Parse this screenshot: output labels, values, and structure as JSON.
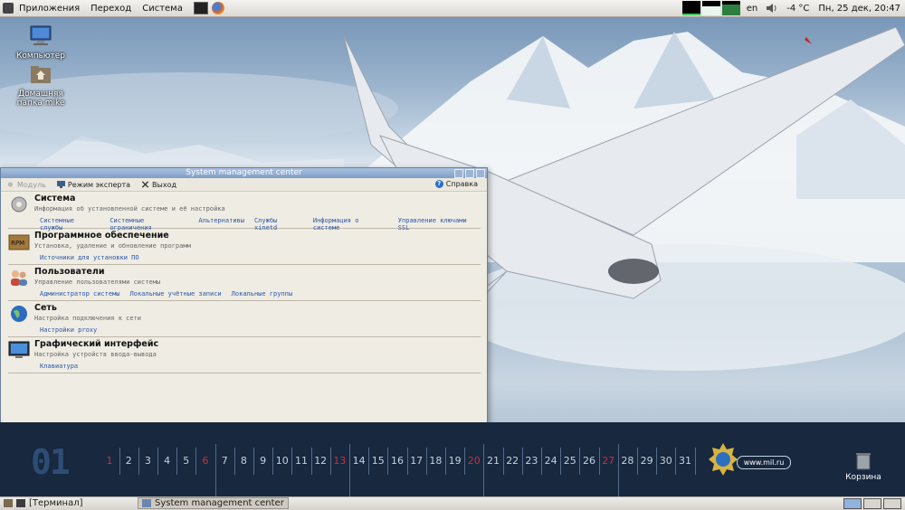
{
  "top_panel": {
    "menus": [
      "Приложения",
      "Переход",
      "Система"
    ],
    "layout": "en",
    "temperature": "-4 °C",
    "datetime": "Пн, 25 дек, 20:47"
  },
  "desktop_icons": [
    {
      "label": "Компьютер"
    },
    {
      "label": "Домашняя папка mike"
    }
  ],
  "window": {
    "title": "System management center",
    "toolbar": {
      "module": "Модуль",
      "expert": "Режим эксперта",
      "exit": "Выход",
      "help": "Справка"
    },
    "sections": [
      {
        "title": "Система",
        "desc": "Информация об установленной системе и её настройка",
        "links": [
          "Системные службы",
          "Системные ограничения",
          "Альтернативы",
          "Службы xinetd",
          "Информация о системе",
          "Управление ключами SSL"
        ]
      },
      {
        "title": "Программное обеспечение",
        "desc": "Установка, удаление и обновление программ",
        "links": [
          "Источники для установки ПО"
        ]
      },
      {
        "title": "Пользователи",
        "desc": "Управление пользователями системы",
        "links": [
          "Администратор системы",
          "Локальные учётные записи",
          "Локальные группы"
        ]
      },
      {
        "title": "Сеть",
        "desc": "Настройка подключения к сети",
        "links": [
          "Настройки proxy"
        ]
      },
      {
        "title": "Графический интерфейс",
        "desc": "Настройка устройств ввода-вывода",
        "links": [
          "Клавиатура"
        ]
      }
    ]
  },
  "calendar": {
    "month": "01",
    "days": [
      "1",
      "2",
      "3",
      "4",
      "5",
      "6",
      "7",
      "8",
      "9",
      "10",
      "11",
      "12",
      "13",
      "14",
      "15",
      "16",
      "17",
      "18",
      "19",
      "20",
      "21",
      "22",
      "23",
      "24",
      "25",
      "26",
      "27",
      "28",
      "29",
      "30",
      "31"
    ],
    "red_days": [
      "1",
      "6",
      "13",
      "20",
      "27"
    ],
    "site": "www.mil.ru",
    "trash_label": "Корзина"
  },
  "taskbar": {
    "items": [
      "[Терминал]",
      "System management center"
    ]
  },
  "colors": {
    "link": "#2a56a8",
    "calendar_bg": "#17283f",
    "holiday": "#c8323a"
  }
}
